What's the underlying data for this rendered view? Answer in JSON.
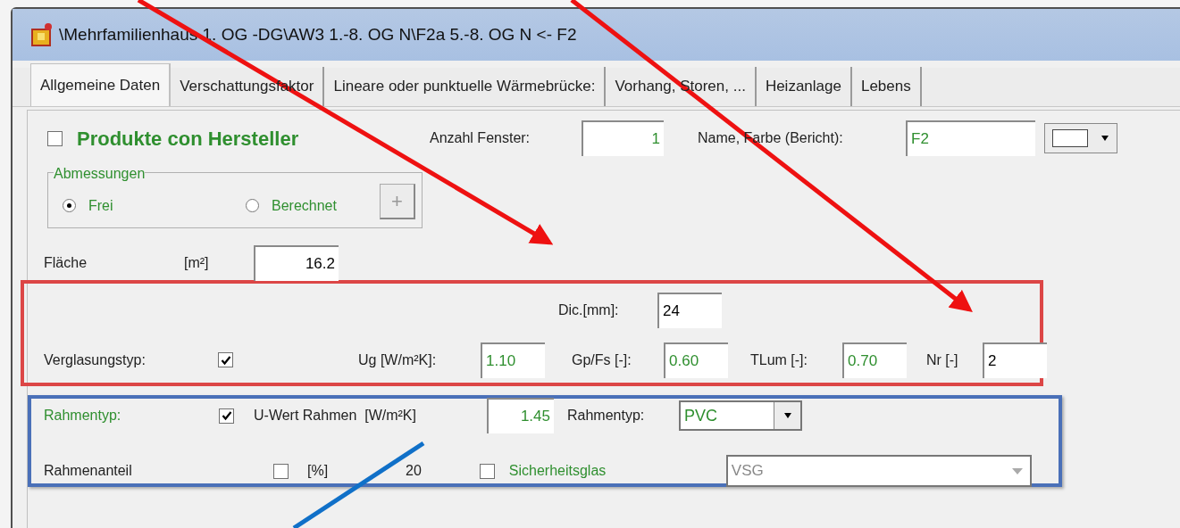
{
  "window": {
    "title": "\\Mehrfamilienhaus 1. OG -DG\\AW3 1.-8. OG N\\F2a 5.-8. OG N <- F2"
  },
  "tabs": [
    {
      "label": "Allgemeine Daten",
      "selected": true
    },
    {
      "label": "Verschattungsfaktor",
      "selected": false
    },
    {
      "label": "Lineare oder punktuelle Wärmebrücke:",
      "selected": false
    },
    {
      "label": "Vorhang, Storen, ...",
      "selected": false
    },
    {
      "label": "Heizanlage",
      "selected": false
    },
    {
      "label": "Lebens",
      "selected": false
    }
  ],
  "product": {
    "label": "Produkte con Hersteller",
    "checked": false
  },
  "anzahl_fenster": {
    "label": "Anzahl Fenster:",
    "value": "1"
  },
  "name_farbe": {
    "label": "Name, Farbe (Bericht):",
    "value": "F2"
  },
  "abmessungen": {
    "title": "Abmessungen",
    "options": [
      {
        "label": "Frei",
        "selected": true
      },
      {
        "label": "Berechnet",
        "selected": false
      }
    ],
    "add_button": "+"
  },
  "flaeche": {
    "label": "Fläche",
    "unit": "[m²]",
    "value": "16.2"
  },
  "verglasung": {
    "dic": {
      "label": "Dic.[mm]:",
      "value": "24"
    },
    "label": "Verglasungstyp:",
    "checked": true,
    "fields": [
      {
        "label": "Ug [W/m²K]:",
        "value": "1.10",
        "green": true
      },
      {
        "label": "Gp/Fs [-]:",
        "value": "0.60",
        "green": true
      },
      {
        "label": "TLum [-]:",
        "value": "0.70",
        "green": true
      },
      {
        "label": "Nr [-]",
        "value": "2",
        "green": false
      }
    ]
  },
  "rahmen": {
    "label": "Rahmentyp:",
    "checked": true,
    "u_label": "U-Wert Rahmen  [W/m²K]",
    "u_value": "1.45",
    "type_label": "Rahmentyp:",
    "type_value": "PVC",
    "anteil_label": "Rahmenanteil",
    "anteil_checked": false,
    "anteil_unit": "[%]",
    "anteil_value": "20",
    "glas": {
      "label": "Sicherheitsglas",
      "checked": false,
      "value": "VSG",
      "disabled": true
    }
  }
}
